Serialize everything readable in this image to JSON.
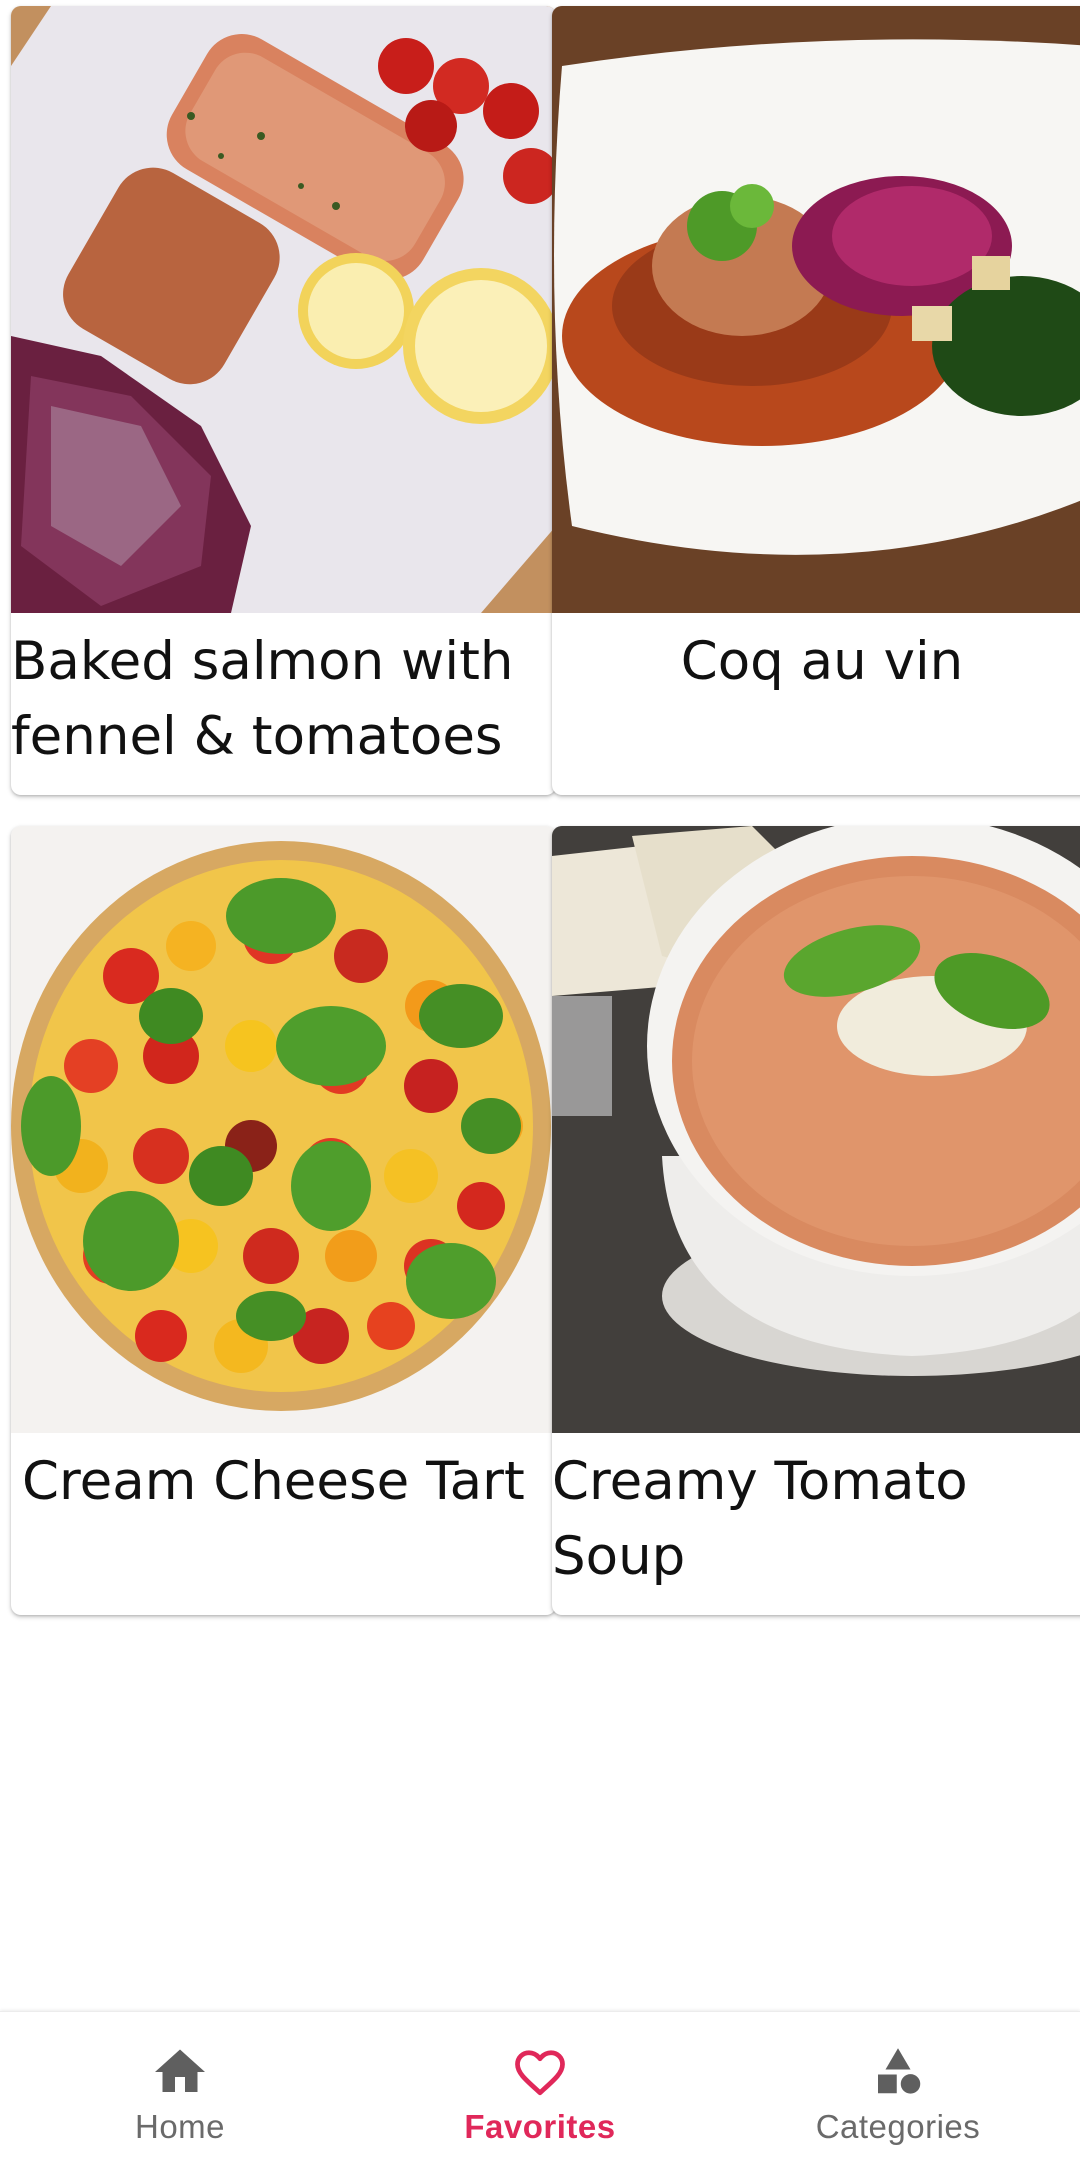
{
  "recipes": [
    {
      "title": "Baked salmon with fennel & tomatoes"
    },
    {
      "title": "Coq au vin"
    },
    {
      "title": "Cream Cheese Tart"
    },
    {
      "title": "Creamy Tomato Soup"
    }
  ],
  "bottom_nav": {
    "items": [
      {
        "label": "Home",
        "icon": "home-icon",
        "active": false
      },
      {
        "label": "Favorites",
        "icon": "heart-icon",
        "active": true
      },
      {
        "label": "Categories",
        "icon": "shapes-icon",
        "active": false
      }
    ],
    "active_color": "#e0285a",
    "inactive_color": "#6a6a6a"
  }
}
